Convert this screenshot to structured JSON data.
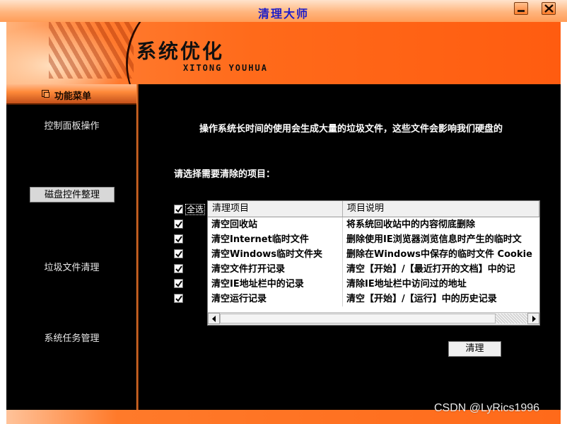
{
  "window": {
    "title": "清理大师",
    "minimize_icon": "minimize-icon",
    "close_icon": "close-icon"
  },
  "banner": {
    "title": "系统优化",
    "subtitle": "XITONG YOUHUA"
  },
  "sidebar": {
    "header": "功能菜单",
    "header_icon": "window-stack-icon",
    "items": [
      {
        "label": "控制面板操作",
        "selected": false
      },
      {
        "label": "磁盘控件整理",
        "selected": true
      },
      {
        "label": "垃圾文件清理",
        "selected": false
      },
      {
        "label": "系统任务管理",
        "selected": false
      }
    ]
  },
  "main": {
    "intro": "操作系统长时间的使用会生成大量的垃圾文件，这些文件会影响我们硬盘的",
    "prompt": "请选择需要清除的项目：",
    "select_all_label": "全选",
    "select_all_checked": true,
    "columns": [
      "清理项目",
      "项目说明"
    ],
    "rows": [
      {
        "item": "清空回收站",
        "desc": "将系统回收站中的内容彻底删除",
        "checked": true
      },
      {
        "item": "清空Internet临时文件",
        "desc": "删除使用IE浏览器浏览信息时产生的临时文",
        "checked": true
      },
      {
        "item": "清空Windows临时文件夹",
        "desc": "删除在Windows中保存的临时文件 Cookie",
        "checked": true
      },
      {
        "item": "清空文件打开记录",
        "desc": "清空【开始】/【最近打开的文档】中的记",
        "checked": true
      },
      {
        "item": "清空IE地址栏中的记录",
        "desc": "清除IE地址栏中访问过的地址",
        "checked": true
      },
      {
        "item": "清空运行记录",
        "desc": "清空【开始】/【运行】中的历史记录",
        "checked": true
      }
    ],
    "clean_button": "清理"
  },
  "watermark": "CSDN @LyRics1996",
  "colors": {
    "title_text": "#1c1cc8",
    "accent_orange": "#ff6a1a",
    "panel_bg": "#000000"
  }
}
